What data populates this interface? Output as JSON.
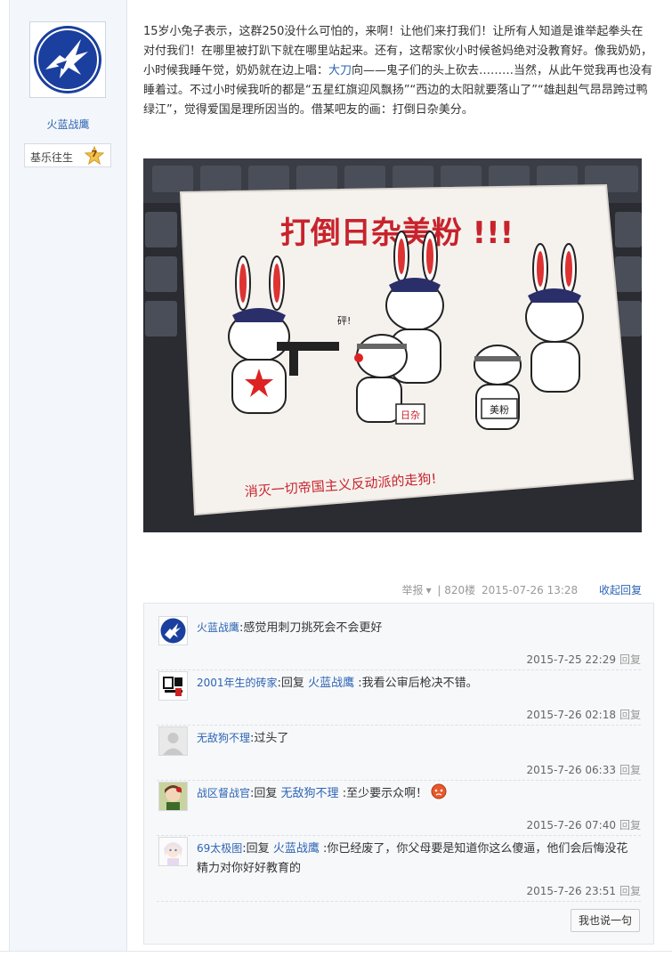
{
  "author": {
    "name": "火蓝战鹰",
    "level_title": "基乐往生",
    "level": "7"
  },
  "post": {
    "text_before_link": "15岁小兔子表示，这群250没什么可怕的，来啊！让他们来打我们！让所有人知道是谁举起拳头在对付我们！在哪里被打趴下就在哪里站起来。还有，这帮家伙小时候爸妈绝对没教育好。像我奶奶，小时候我睡午觉，奶奶就在边上唱：",
    "link_text": "大刀",
    "text_after_link": "向——鬼子们的头上砍去………当然，从此午觉我再也没有睡着过。不过小时候我听的都是“五星红旗迎风飘扬”“西边的太阳就要落山了”“雄赳赳气昂昂跨过鸭绿江”，觉得爱国是理所因当的。借某吧友的画：打倒日杂美分。",
    "image": {
      "headline": "打倒日杂美粉 !!!",
      "bubble": "砰!",
      "sign_left": "日杂",
      "sign_right": "美粉",
      "bottom_caption": "消灭一切帝国主义反动派的走狗!"
    }
  },
  "meta": {
    "report": "举报",
    "floor": "| 820楼",
    "time": "2015-07-26 13:28",
    "collapse": "收起回复"
  },
  "replies": [
    {
      "user": "火蓝战鹰",
      "prefix": "",
      "target": "",
      "text": ":感觉用刺刀挑死会不会更好",
      "time": "2015-7-25 22:29",
      "reply": "回复"
    },
    {
      "user": "2001年生的砖家",
      "prefix": ":回复",
      "target": "火蓝战鹰",
      "text": ":我看公审后枪决不错。",
      "time": "2015-7-26 02:18",
      "reply": "回复"
    },
    {
      "user": "无敌狗不理",
      "prefix": "",
      "target": "",
      "text": ":过头了",
      "time": "2015-7-26 06:33",
      "reply": "回复"
    },
    {
      "user": "战区督战官",
      "prefix": ":回复",
      "target": "无敌狗不理",
      "text": ":至少要示众啊！",
      "time": "2015-7-26 07:40",
      "reply": "回复"
    },
    {
      "user": "69太极图",
      "prefix": ":回复",
      "target": "火蓝战鹰",
      "text": ":你已经废了，你父母要是知道你这么傻逼，他们会后悔没花精力对你好好教育的",
      "time": "2015-7-26 23:51",
      "reply": "回复"
    }
  ],
  "say_button": "我也说一句",
  "colors": {
    "link": "#2d64b3",
    "sidebar_bg": "#f3f6fb",
    "reply_bg": "#f7f8fa"
  }
}
